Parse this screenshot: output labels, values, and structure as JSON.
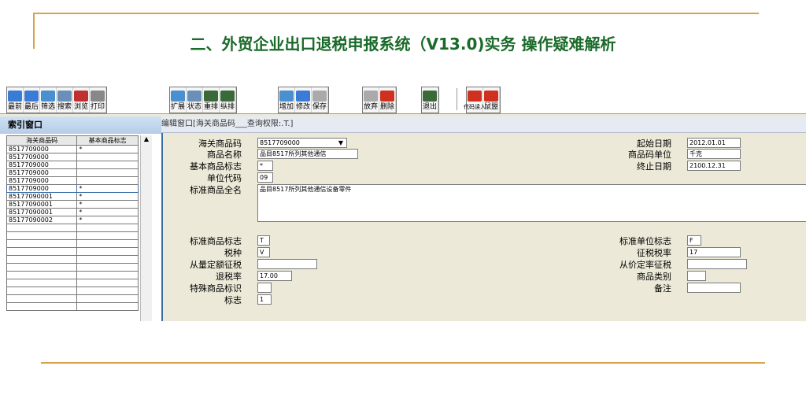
{
  "slide": {
    "title": "二、外贸企业出口退税申报系统（V13.0)实务 操作疑难解析"
  },
  "toolbar": {
    "buttons": [
      {
        "label": "最前",
        "icon": "first-icon",
        "color": "#3a7bd5"
      },
      {
        "label": "最后",
        "icon": "last-icon",
        "color": "#3a7bd5"
      },
      {
        "label": "筛选",
        "icon": "filter-icon",
        "color": "#4a90d0"
      },
      {
        "label": "搜索",
        "icon": "search-icon",
        "color": "#6a8fb8"
      },
      {
        "label": "浏览",
        "icon": "browse-icon",
        "color": "#c03030"
      },
      {
        "label": "打印",
        "icon": "print-icon",
        "color": "#888888"
      },
      {
        "label": "扩展",
        "icon": "expand-icon",
        "color": "#4a90d0"
      },
      {
        "label": "状态",
        "icon": "status-icon",
        "color": "#6a8fb8"
      },
      {
        "label": "重排",
        "icon": "rearrange-icon",
        "color": "#3a6a3a"
      },
      {
        "label": "纵排",
        "icon": "vertical-icon",
        "color": "#3a6a3a"
      },
      {
        "label": "增加",
        "icon": "add-icon",
        "color": "#4a90d0"
      },
      {
        "label": "修改",
        "icon": "edit-icon",
        "color": "#3a7bd5"
      },
      {
        "label": "保存",
        "icon": "save-icon",
        "color": "#aaaaaa"
      },
      {
        "label": "放弃",
        "icon": "discard-icon",
        "color": "#aaaaaa"
      },
      {
        "label": "删除",
        "icon": "delete-icon",
        "color": "#d03020"
      },
      {
        "label": "退出",
        "icon": "exit-icon",
        "color": "#3a6a3a"
      },
      {
        "label": "代码读入",
        "icon": "code-read-icon",
        "color": "#d03020"
      },
      {
        "label": "鼠盟",
        "icon": "mouse-icon",
        "color": "#d03020"
      }
    ]
  },
  "index_window": {
    "title": "索引窗口",
    "columns": [
      "海关商品码",
      "基本商品标志"
    ],
    "rows": [
      {
        "code": "8517709000",
        "flag": "*"
      },
      {
        "code": "8517709000",
        "flag": ""
      },
      {
        "code": "8517709000",
        "flag": ""
      },
      {
        "code": "8517709000",
        "flag": ""
      },
      {
        "code": "8517709000",
        "flag": ""
      },
      {
        "code": "8517709000",
        "flag": "*"
      },
      {
        "code": "85177090001",
        "flag": "*"
      },
      {
        "code": "85177090001",
        "flag": "*"
      },
      {
        "code": "85177090001",
        "flag": "*"
      },
      {
        "code": "85177090002",
        "flag": "*"
      }
    ],
    "selected_index": 5,
    "scroll_up": "▲"
  },
  "edit_window": {
    "title": "编辑窗口[海关商品码___查询权限:.T.]",
    "left_fields": [
      {
        "label": "海关商品码",
        "value": "8517709000",
        "dropdown": "▼"
      },
      {
        "label": "商品名称",
        "value": "品目8517所列其他通信"
      },
      {
        "label": "基本商品标志",
        "value": "*"
      },
      {
        "label": "单位代码",
        "value": "09"
      },
      {
        "label": "标准商品全名",
        "value": "品目8517所列其他通信设备零件"
      },
      {
        "label": "标准商品标志",
        "value": "T"
      },
      {
        "label": "税种",
        "value": "V"
      },
      {
        "label": "从量定额征税",
        "value": ""
      },
      {
        "label": "退税率",
        "value": "17.00"
      },
      {
        "label": "特殊商品标识",
        "value": ""
      },
      {
        "label": "标志",
        "value": "1"
      }
    ],
    "right_top_fields": [
      {
        "label": "起始日期",
        "value": "2012.01.01"
      },
      {
        "label": "商品码单位",
        "value": "千克"
      },
      {
        "label": "终止日期",
        "value": "2100.12.31"
      }
    ],
    "right_bottom_fields": [
      {
        "label": "标准单位标志",
        "value": "F"
      },
      {
        "label": "征税税率",
        "value": "17"
      },
      {
        "label": "从价定率征税",
        "value": ""
      },
      {
        "label": "商品类别",
        "value": ""
      },
      {
        "label": "备注",
        "value": ""
      }
    ]
  }
}
